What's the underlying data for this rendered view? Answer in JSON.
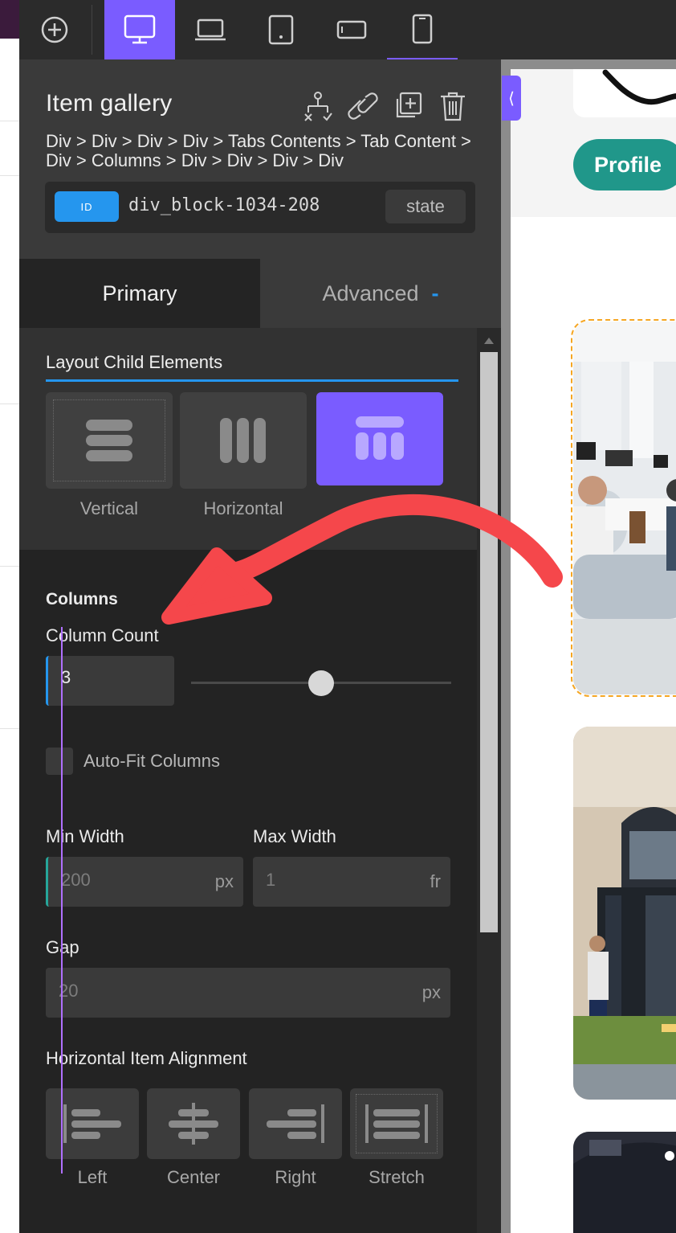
{
  "toolbar": {
    "add_icon": "plus-circle-icon",
    "devices": [
      {
        "name": "desktop",
        "icon": "monitor-icon",
        "active": true
      },
      {
        "name": "laptop",
        "icon": "laptop-icon"
      },
      {
        "name": "tablet",
        "icon": "tablet-icon"
      },
      {
        "name": "landscape",
        "icon": "tablet-landscape-icon"
      },
      {
        "name": "phone",
        "icon": "phone-icon"
      }
    ],
    "accent_color": "#7a5cff"
  },
  "panel": {
    "title": "Item gallery",
    "breadcrumb": "Div > Div > Div > Div > Tabs Contents > Tab Content > Div > Columns > Div > Div > Div > Div",
    "id_badge": "ID",
    "element_id": "div_block-1034-208",
    "state_label": "state",
    "tabs": {
      "primary": "Primary",
      "advanced": "Advanced",
      "advanced_marker": "-"
    },
    "layout": {
      "title": "Layout Child Elements",
      "options": [
        {
          "label": "Vertical"
        },
        {
          "label": "Horizontal"
        },
        {
          "label": "Grid",
          "active": true
        }
      ]
    },
    "columns": {
      "heading": "Columns",
      "count_label": "Column Count",
      "count_value": "3",
      "slider_fraction": 0.5,
      "autofit_label": "Auto-Fit Columns",
      "autofit_checked": false,
      "min_width_label": "Min Width",
      "min_width_value": "200",
      "min_width_unit": "px",
      "max_width_label": "Max Width",
      "max_width_value": "1",
      "max_width_unit": "fr",
      "gap_label": "Gap",
      "gap_value": "20",
      "gap_unit": "px"
    },
    "halign": {
      "label": "Horizontal Item Alignment",
      "options": [
        {
          "label": "Left"
        },
        {
          "label": "Center"
        },
        {
          "label": "Right"
        },
        {
          "label": "Stretch",
          "active": true
        }
      ]
    }
  },
  "canvas": {
    "profile_button": "Profile"
  },
  "annotation": {
    "arrow_color": "#f5474b"
  }
}
